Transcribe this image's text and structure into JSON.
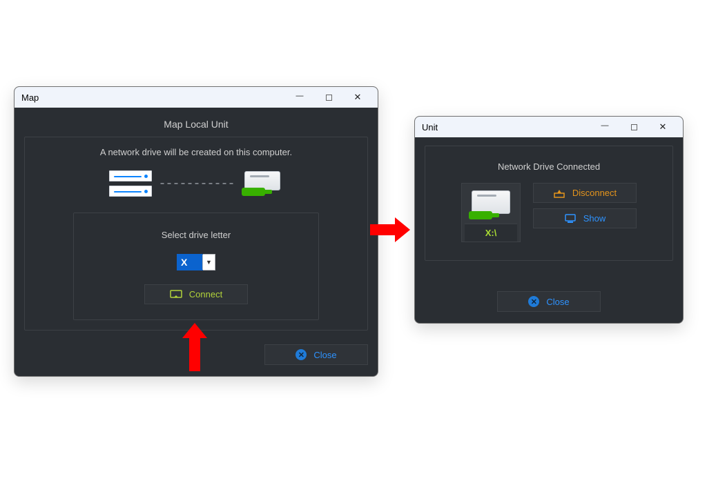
{
  "map": {
    "title": "Map",
    "heading": "Map Local Unit",
    "description": "A network drive will be created on this computer.",
    "select_label": "Select drive letter",
    "drive_letter": "X",
    "connect_label": "Connect",
    "close_label": "Close"
  },
  "unit": {
    "title": "Unit",
    "heading": "Network Drive Connected",
    "drive_label": "X:\\",
    "disconnect_label": "Disconnect",
    "show_label": "Show",
    "close_label": "Close"
  },
  "colors": {
    "bg": "#2a2e33",
    "accent_green": "#b2d33a",
    "accent_blue": "#2e93ff",
    "accent_orange": "#e4941c",
    "arrow_red": "#ff0000"
  }
}
